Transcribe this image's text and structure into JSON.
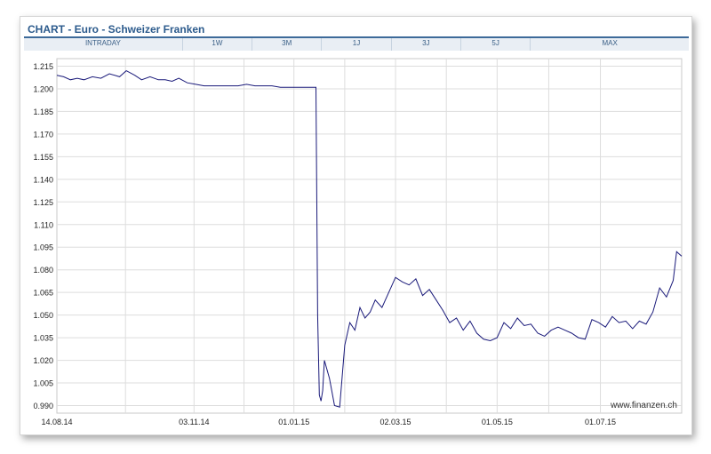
{
  "title": "CHART - Euro - Schweizer Franken",
  "tabs": [
    "INTRADAY",
    "1W",
    "3M",
    "1J",
    "3J",
    "5J",
    "MAX"
  ],
  "watermark": "www.finanzen.ch",
  "colors": {
    "line": "#1a1a7a",
    "title": "#2b5a8c",
    "grid": "#dddddd"
  },
  "chart_data": {
    "type": "line",
    "title": "CHART - Euro - Schweizer Franken",
    "xlabel": "",
    "ylabel": "",
    "ylim": [
      0.985,
      1.22
    ],
    "xlim": [
      "2014-08-14",
      "2015-08-18"
    ],
    "yticks": [
      "1.215",
      "1.200",
      "1.185",
      "1.170",
      "1.155",
      "1.140",
      "1.125",
      "1.110",
      "1.095",
      "1.080",
      "1.065",
      "1.050",
      "1.035",
      "1.020",
      "1.005",
      "0.990"
    ],
    "xticks": [
      {
        "label": "14.08.14",
        "date": "2014-08-14"
      },
      {
        "label": "03.11.14",
        "date": "2014-11-03"
      },
      {
        "label": "01.01.15",
        "date": "2015-01-01"
      },
      {
        "label": "02.03.15",
        "date": "2015-03-02"
      },
      {
        "label": "01.05.15",
        "date": "2015-05-01"
      },
      {
        "label": "01.07.15",
        "date": "2015-07-01"
      }
    ],
    "grid": true,
    "series": [
      {
        "x": [
          "2014-08-14",
          "2014-08-18",
          "2014-08-22",
          "2014-08-26",
          "2014-08-30",
          "2014-09-04",
          "2014-09-09",
          "2014-09-14",
          "2014-09-20",
          "2014-09-24",
          "2014-09-29",
          "2014-10-03",
          "2014-10-08",
          "2014-10-13",
          "2014-10-17",
          "2014-10-21",
          "2014-10-25",
          "2014-10-30",
          "2014-11-04",
          "2014-11-09",
          "2014-11-14",
          "2014-11-19",
          "2014-11-24",
          "2014-11-29",
          "2014-12-04",
          "2014-12-09",
          "2014-12-14",
          "2014-12-19",
          "2014-12-24",
          "2014-12-29",
          "2015-01-03",
          "2015-01-08",
          "2015-01-14",
          "2015-01-15",
          "2015-01-16",
          "2015-01-17",
          "2015-01-18",
          "2015-01-19",
          "2015-01-22",
          "2015-01-25",
          "2015-01-28",
          "2015-01-31",
          "2015-02-03",
          "2015-02-06",
          "2015-02-09",
          "2015-02-12",
          "2015-02-15",
          "2015-02-18",
          "2015-02-22",
          "2015-02-26",
          "2015-03-02",
          "2015-03-06",
          "2015-03-10",
          "2015-03-14",
          "2015-03-18",
          "2015-03-22",
          "2015-03-26",
          "2015-03-30",
          "2015-04-03",
          "2015-04-07",
          "2015-04-11",
          "2015-04-15",
          "2015-04-19",
          "2015-04-23",
          "2015-04-27",
          "2015-05-01",
          "2015-05-05",
          "2015-05-09",
          "2015-05-13",
          "2015-05-17",
          "2015-05-21",
          "2015-05-25",
          "2015-05-29",
          "2015-06-02",
          "2015-06-06",
          "2015-06-10",
          "2015-06-14",
          "2015-06-18",
          "2015-06-22",
          "2015-06-26",
          "2015-06-30",
          "2015-07-04",
          "2015-07-08",
          "2015-07-12",
          "2015-07-16",
          "2015-07-20",
          "2015-07-24",
          "2015-07-28",
          "2015-08-01",
          "2015-08-05",
          "2015-08-09",
          "2015-08-13",
          "2015-08-15",
          "2015-08-18"
        ],
        "values": [
          1.209,
          1.208,
          1.206,
          1.207,
          1.206,
          1.208,
          1.207,
          1.21,
          1.208,
          1.212,
          1.209,
          1.206,
          1.208,
          1.206,
          1.206,
          1.205,
          1.207,
          1.204,
          1.203,
          1.202,
          1.202,
          1.202,
          1.202,
          1.202,
          1.203,
          1.202,
          1.202,
          1.202,
          1.201,
          1.201,
          1.201,
          1.201,
          1.201,
          1.05,
          0.997,
          0.993,
          1.0,
          1.02,
          1.008,
          0.99,
          0.989,
          1.03,
          1.045,
          1.04,
          1.055,
          1.048,
          1.052,
          1.06,
          1.055,
          1.065,
          1.075,
          1.072,
          1.07,
          1.074,
          1.063,
          1.067,
          1.06,
          1.053,
          1.045,
          1.048,
          1.04,
          1.046,
          1.038,
          1.034,
          1.033,
          1.035,
          1.045,
          1.041,
          1.048,
          1.043,
          1.044,
          1.038,
          1.036,
          1.04,
          1.042,
          1.04,
          1.038,
          1.035,
          1.034,
          1.047,
          1.045,
          1.042,
          1.049,
          1.045,
          1.046,
          1.041,
          1.046,
          1.044,
          1.052,
          1.068,
          1.062,
          1.073,
          1.092,
          1.089
        ]
      }
    ]
  }
}
